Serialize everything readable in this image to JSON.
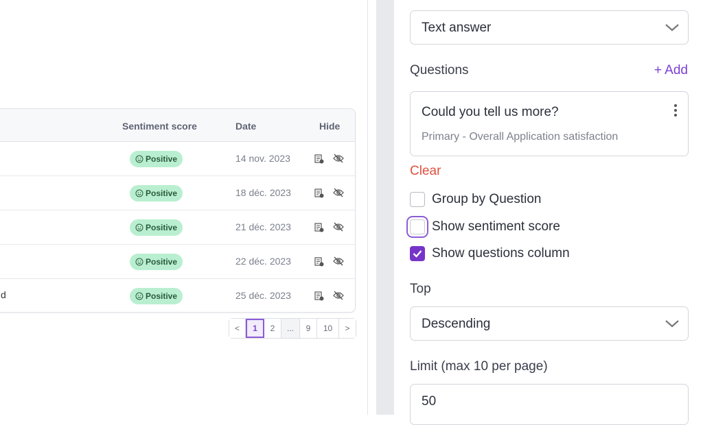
{
  "table": {
    "headers": {
      "sentiment": "Sentiment score",
      "date": "Date",
      "hide": "Hide"
    },
    "rows": [
      {
        "text": "",
        "sentiment": "Positive",
        "date": "14 nov. 2023"
      },
      {
        "text": "",
        "sentiment": "Positive",
        "date": "18 déc. 2023"
      },
      {
        "text": "",
        "sentiment": "Positive",
        "date": "21 déc. 2023"
      },
      {
        "text": "",
        "sentiment": "Positive",
        "date": "22 déc. 2023"
      },
      {
        "text": "d",
        "sentiment": "Positive",
        "date": "25 déc. 2023"
      }
    ],
    "pagination": {
      "prev": "<",
      "pages": [
        "1",
        "2",
        "...",
        "9",
        "10"
      ],
      "next": ">",
      "current": "1"
    }
  },
  "panel": {
    "answer_type": "Text answer",
    "questions_label": "Questions",
    "add_label": "+ Add",
    "question": {
      "title": "Could you tell us more?",
      "subtitle": "Primary - Overall Application satisfaction"
    },
    "clear_label": "Clear",
    "checkboxes": [
      {
        "label": "Group by Question",
        "checked": false
      },
      {
        "label": "Show sentiment score",
        "checked": false
      },
      {
        "label": "Show questions column",
        "checked": true
      }
    ],
    "top_label": "Top",
    "top_value": "Descending",
    "limit_label": "Limit (max 10 per page)",
    "limit_value": "50"
  },
  "colors": {
    "accent": "#7634c9",
    "positive_badge": "#b9efd0",
    "clear": "#e0513f"
  }
}
